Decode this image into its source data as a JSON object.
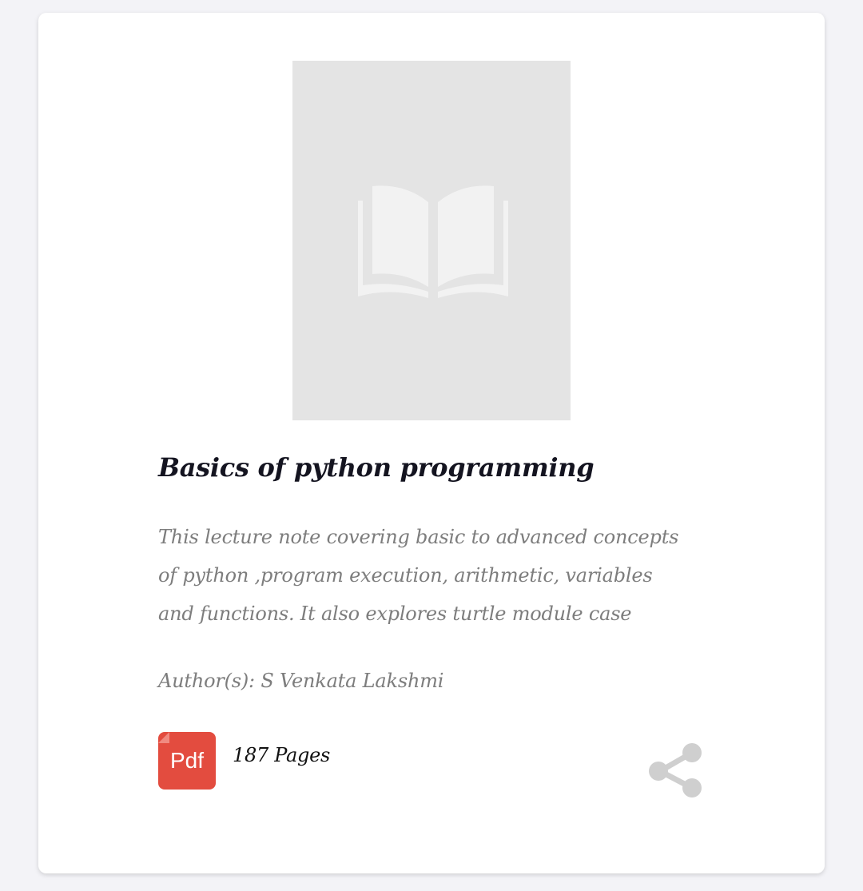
{
  "book": {
    "title": "Basics of python programming",
    "description": "This lecture note covering basic to advanced concepts of python ,program execution, arithmetic, variables and functions. It also explores turtle module case",
    "authors_label": "Author(s):",
    "authors": "S Venkata Lakshmi",
    "authors_line": "Author(s): S Venkata Lakshmi",
    "pdf_badge_label": "Pdf",
    "pages_text": "187 Pages",
    "cover_icon": "open-book-icon",
    "share_icon": "share-icon"
  },
  "colors": {
    "background": "#f3f3f7",
    "card": "#ffffff",
    "cover_placeholder": "#e4e4e4",
    "title": "#141420",
    "muted_text": "#7d7d7d",
    "pdf_badge": "#e34c3f",
    "share_icon": "#cfcfcf"
  }
}
